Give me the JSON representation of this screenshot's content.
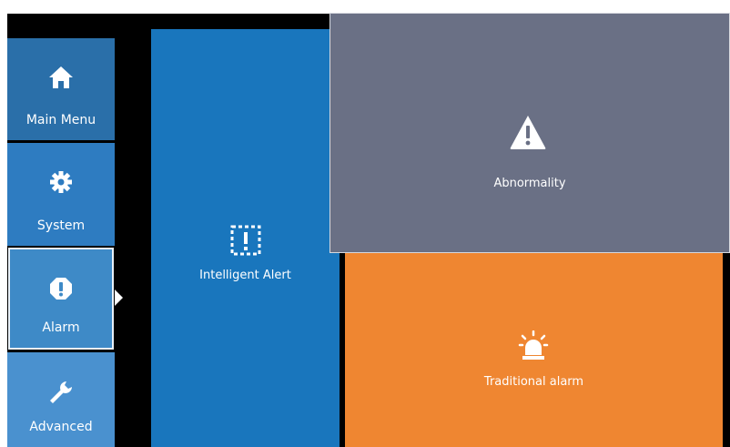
{
  "sidebar": {
    "items": [
      {
        "label": "Main Menu",
        "icon": "home-icon"
      },
      {
        "label": "System",
        "icon": "gear-icon"
      },
      {
        "label": "Alarm",
        "icon": "alarm-exclamation-icon",
        "selected": true
      },
      {
        "label": "Advanced",
        "icon": "wrench-icon"
      }
    ]
  },
  "tiles": {
    "intelligent_alert": {
      "label": "Intelligent Alert",
      "icon": "intelligent-alert-icon",
      "color": "#1976bd"
    },
    "abnormality": {
      "label": "Abnormality",
      "icon": "warning-triangle-icon",
      "color": "#6a7085"
    },
    "traditional_alarm": {
      "label": "Traditional alarm",
      "icon": "siren-icon",
      "color": "#ef8631"
    }
  }
}
